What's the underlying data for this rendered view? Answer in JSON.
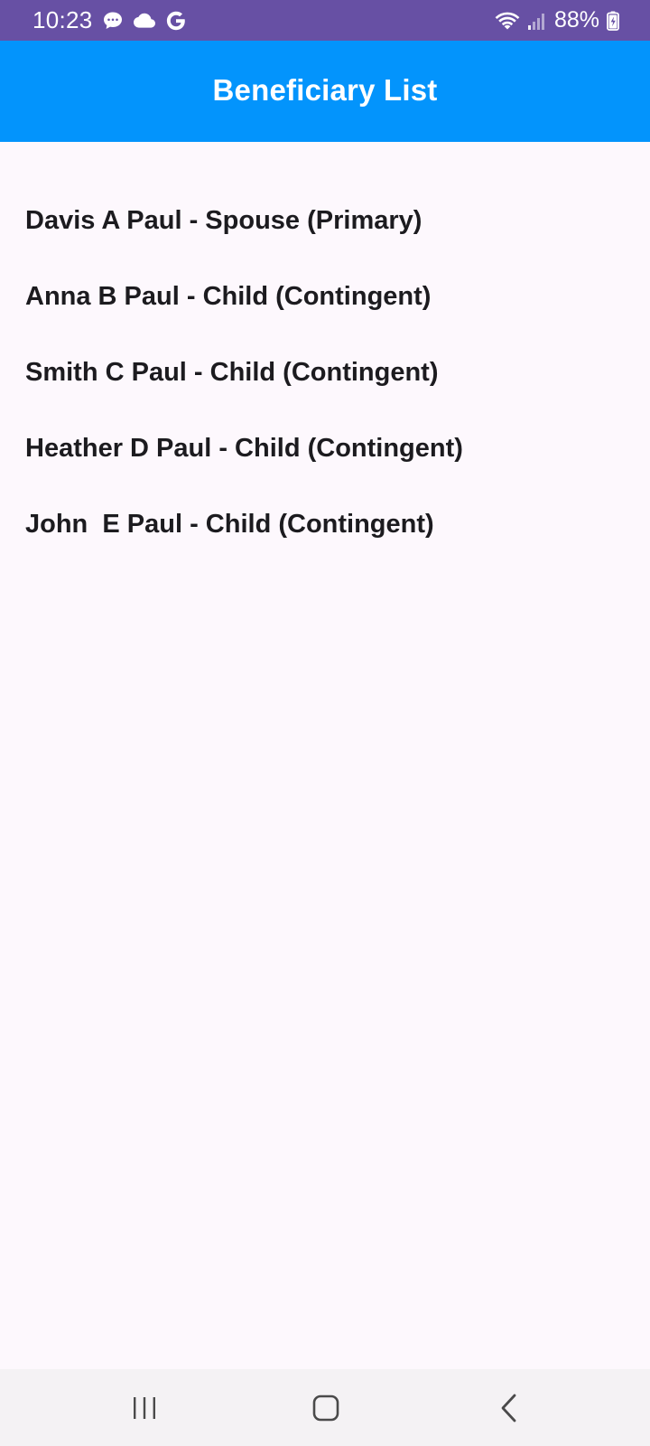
{
  "status_bar": {
    "time": "10:23",
    "battery": "88%",
    "left_icons": [
      "chat-bubble-icon",
      "cloud-icon",
      "google-g-icon"
    ],
    "right_icons": [
      "wifi-icon",
      "signal-icon",
      "battery-charging-icon"
    ],
    "background": "#6750A4"
  },
  "app_bar": {
    "title": "Beneficiary List",
    "background": "#0394FC"
  },
  "beneficiaries": [
    {
      "label": "Davis A Paul - Spouse (Primary)"
    },
    {
      "label": "Anna B Paul - Child (Contingent)"
    },
    {
      "label": "Smith C Paul - Child (Contingent)"
    },
    {
      "label": "Heather D Paul - Child (Contingent)"
    },
    {
      "label": "John  E Paul - Child (Contingent)"
    }
  ],
  "nav_bar": {
    "buttons": [
      "recents-icon",
      "home-icon",
      "back-icon"
    ]
  }
}
